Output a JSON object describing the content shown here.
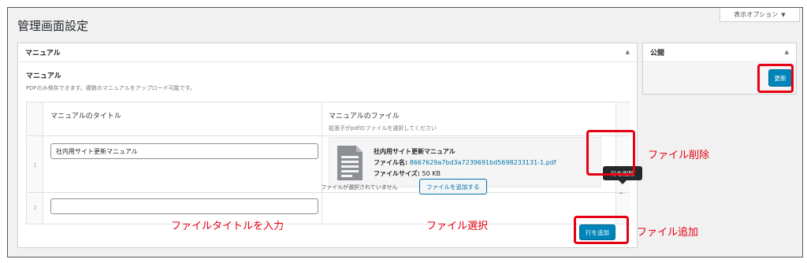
{
  "header": {
    "title": "管理画面設定",
    "screen_options": "表示オプション",
    "screen_options_caret": "▼"
  },
  "manual_box": {
    "title": "マニュアル",
    "toggle": "▲",
    "field_label": "マニュアル",
    "field_desc": "PDFのみ保存できます。複数のマニュアルをアップロード可能です。",
    "columns": [
      {
        "label": "マニュアルのタイトル",
        "desc": ""
      },
      {
        "label": "マニュアルのファイル",
        "desc": "拡張子がpdfのファイルを選択してください"
      }
    ],
    "rows": [
      {
        "num": "1",
        "title_value": "社内用サイト更新マニュアル",
        "file": {
          "name": "社内用サイト更新マニュアル",
          "filename_label": "ファイル名:",
          "filename": "8667629a7bd3a7239691bd5698233131-1.pdf",
          "size_label": "ファイルサイズ:",
          "size": "50 KB"
        }
      },
      {
        "num": "2",
        "title_value": "",
        "no_file_text": "ファイルが選択されていません",
        "add_file_button": "ファイルを追加する"
      }
    ],
    "delete_row_tooltip": "行を削除",
    "remove_icon": "minus-icon",
    "add_row_button": "行を追加"
  },
  "publish_box": {
    "title": "公開",
    "toggle": "▲",
    "update_button": "更新"
  },
  "annotations": {
    "file_delete": "ファイル削除",
    "title_input": "ファイルタイトルを入力",
    "file_select": "ファイル選択",
    "file_add": "ファイル追加"
  },
  "colors": {
    "highlight": "#e60012",
    "primary": "#0085ba",
    "link": "#0073aa"
  }
}
